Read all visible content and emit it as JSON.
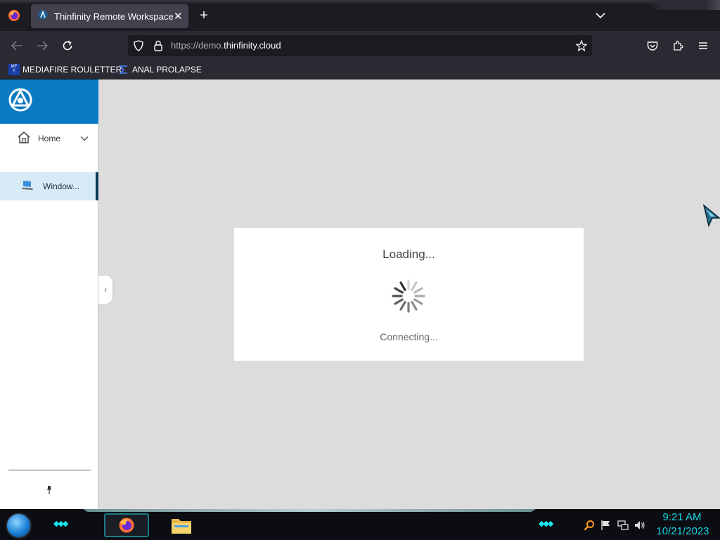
{
  "browser": {
    "tab": {
      "title": "Thinfinity Remote Workspace",
      "close_glyph": "✕"
    },
    "new_tab_glyph": "+",
    "url": {
      "prefix": "https://demo.",
      "domain": "thinfinity.cloud"
    },
    "bookmarks": [
      {
        "label": "MEDIAFIRE ROULETTER",
        "icon_text": "MF T"
      },
      {
        "label": "ANAL PROLAPSE",
        "icon": "sigma-icon"
      }
    ],
    "icons": [
      "firefox-icon",
      "back-icon",
      "forward-icon",
      "reload-icon",
      "shield-icon",
      "lock-icon",
      "star-icon",
      "pocket-icon",
      "extensions-icon",
      "menu-icon",
      "tabs-list-icon"
    ]
  },
  "sidebar": {
    "items": [
      {
        "label": "Home",
        "icon": "home-icon"
      },
      {
        "label": "Window...",
        "icon": "laptop-icon"
      }
    ],
    "collapse_glyph": "‹"
  },
  "dialog": {
    "title": "Loading...",
    "status": "Connecting..."
  },
  "taskbar": {
    "time": "9:21 AM",
    "date": "10/21/2023",
    "accent_color": "#19d6e6"
  },
  "colors": {
    "brand_blue": "#0a7ac4",
    "selected_item_bg": "#d7ebf6"
  }
}
